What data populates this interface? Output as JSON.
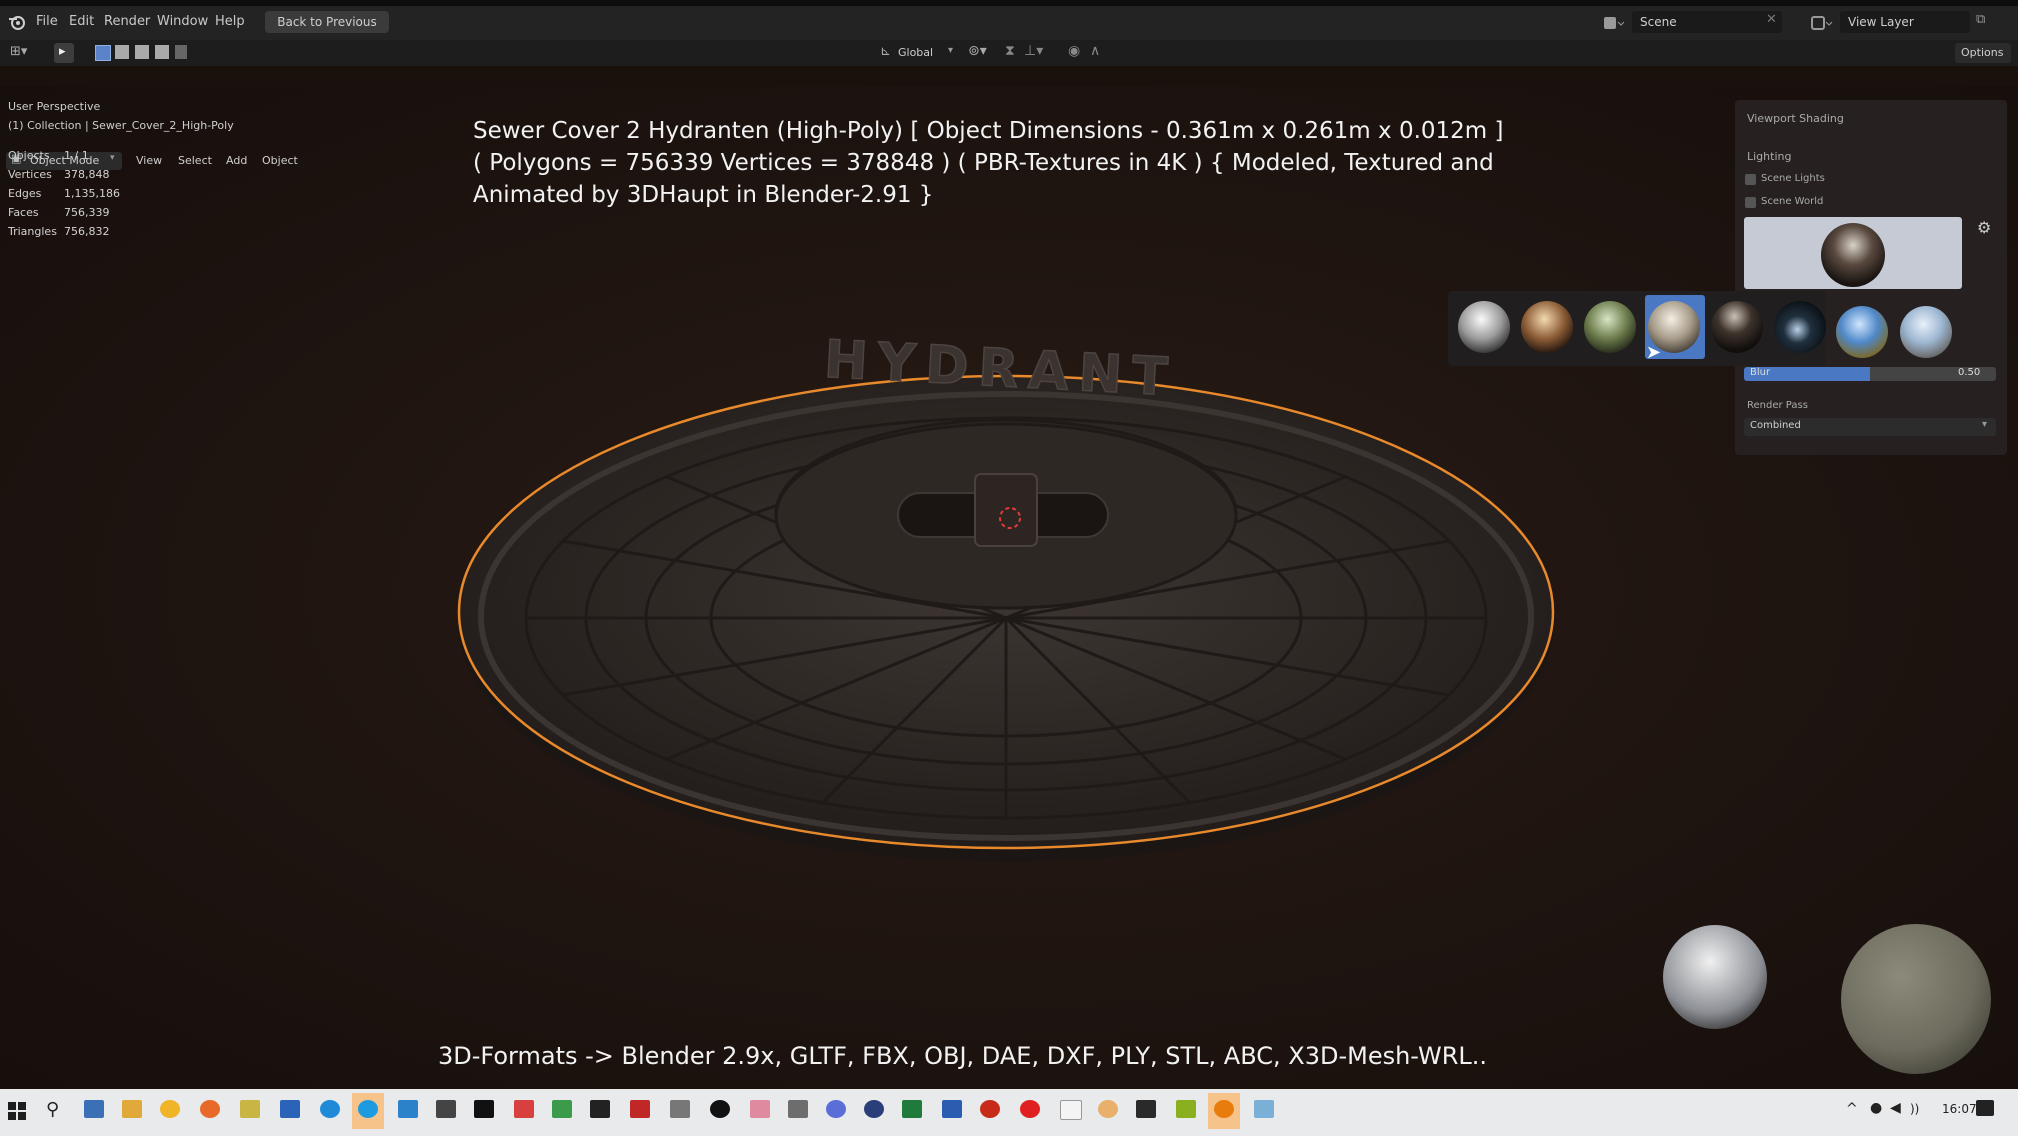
{
  "topbar": {
    "menu": [
      "File",
      "Edit",
      "Render",
      "Window",
      "Help"
    ],
    "back_button": "Back to Previous",
    "scene": "Scene",
    "view_layer": "View Layer"
  },
  "header": {
    "orientation": "Global",
    "options": "Options"
  },
  "viewport_header": {
    "mode": "Object Mode",
    "menu": [
      "View",
      "Select",
      "Add",
      "Object"
    ]
  },
  "overlay": {
    "perspective": "User Perspective",
    "collection": "(1) Collection | Sewer_Cover_2_High-Poly",
    "stats": [
      {
        "label": "Objects",
        "value": "1 / 1"
      },
      {
        "label": "Vertices",
        "value": "378,848"
      },
      {
        "label": "Edges",
        "value": "1,135,186"
      },
      {
        "label": "Faces",
        "value": "756,339"
      },
      {
        "label": "Triangles",
        "value": "756,832"
      }
    ]
  },
  "captions": {
    "title_lines": [
      "Sewer Cover 2 Hydranten (High-Poly) [ Object Dimensions -  0.361m x 0.261m x 0.012m ]",
      "( Polygons = 756339 Vertices = 378848 ) ( PBR-Textures in 4K ) { Modeled, Textured and",
      "Animated by 3DHaupt in Blender-2.91 }"
    ],
    "formats": "3D-Formats -> Blender 2.9x, GLTF, FBX, OBJ, DAE, DXF, PLY, STL, ABC, X3D-Mesh-WRL.."
  },
  "model": {
    "embossed_text": "HYDRANT"
  },
  "shading_panel": {
    "title": "Viewport Shading",
    "lighting": "Lighting",
    "scene_lights": "Scene Lights",
    "scene_world": "Scene World",
    "blur_label": "Blur",
    "blur_value": "0.50",
    "blur_fraction": 0.5,
    "render_pass_label": "Render Pass",
    "render_pass_value": "Combined"
  },
  "taskbar": {
    "clock": "16:07"
  },
  "colors": {
    "selection_outline": "#e8892c",
    "accent_blue": "#4a78c2",
    "viewport_bg": "#1e1410"
  }
}
